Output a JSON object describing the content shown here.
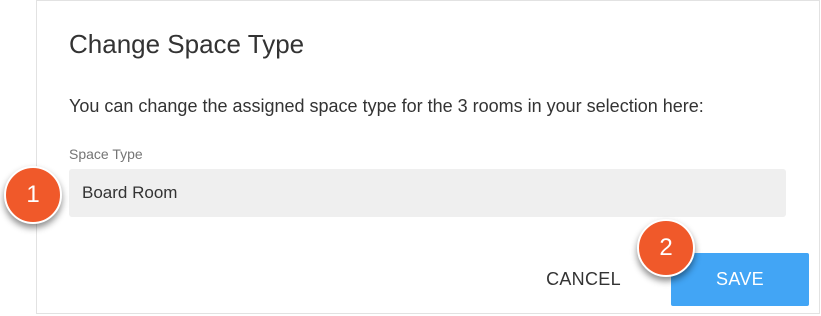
{
  "dialog": {
    "title": "Change Space Type",
    "description": "You can change the assigned space type for the 3 rooms in your selection here:",
    "field": {
      "label": "Space Type",
      "value": "Board Room"
    },
    "buttons": {
      "cancel_label": "CANCEL",
      "save_label": "SAVE"
    }
  },
  "callouts": {
    "first": "1",
    "second": "2"
  },
  "colors": {
    "accent": "#42a5f5",
    "callout": "#f0592a",
    "field_background": "#efefef"
  }
}
